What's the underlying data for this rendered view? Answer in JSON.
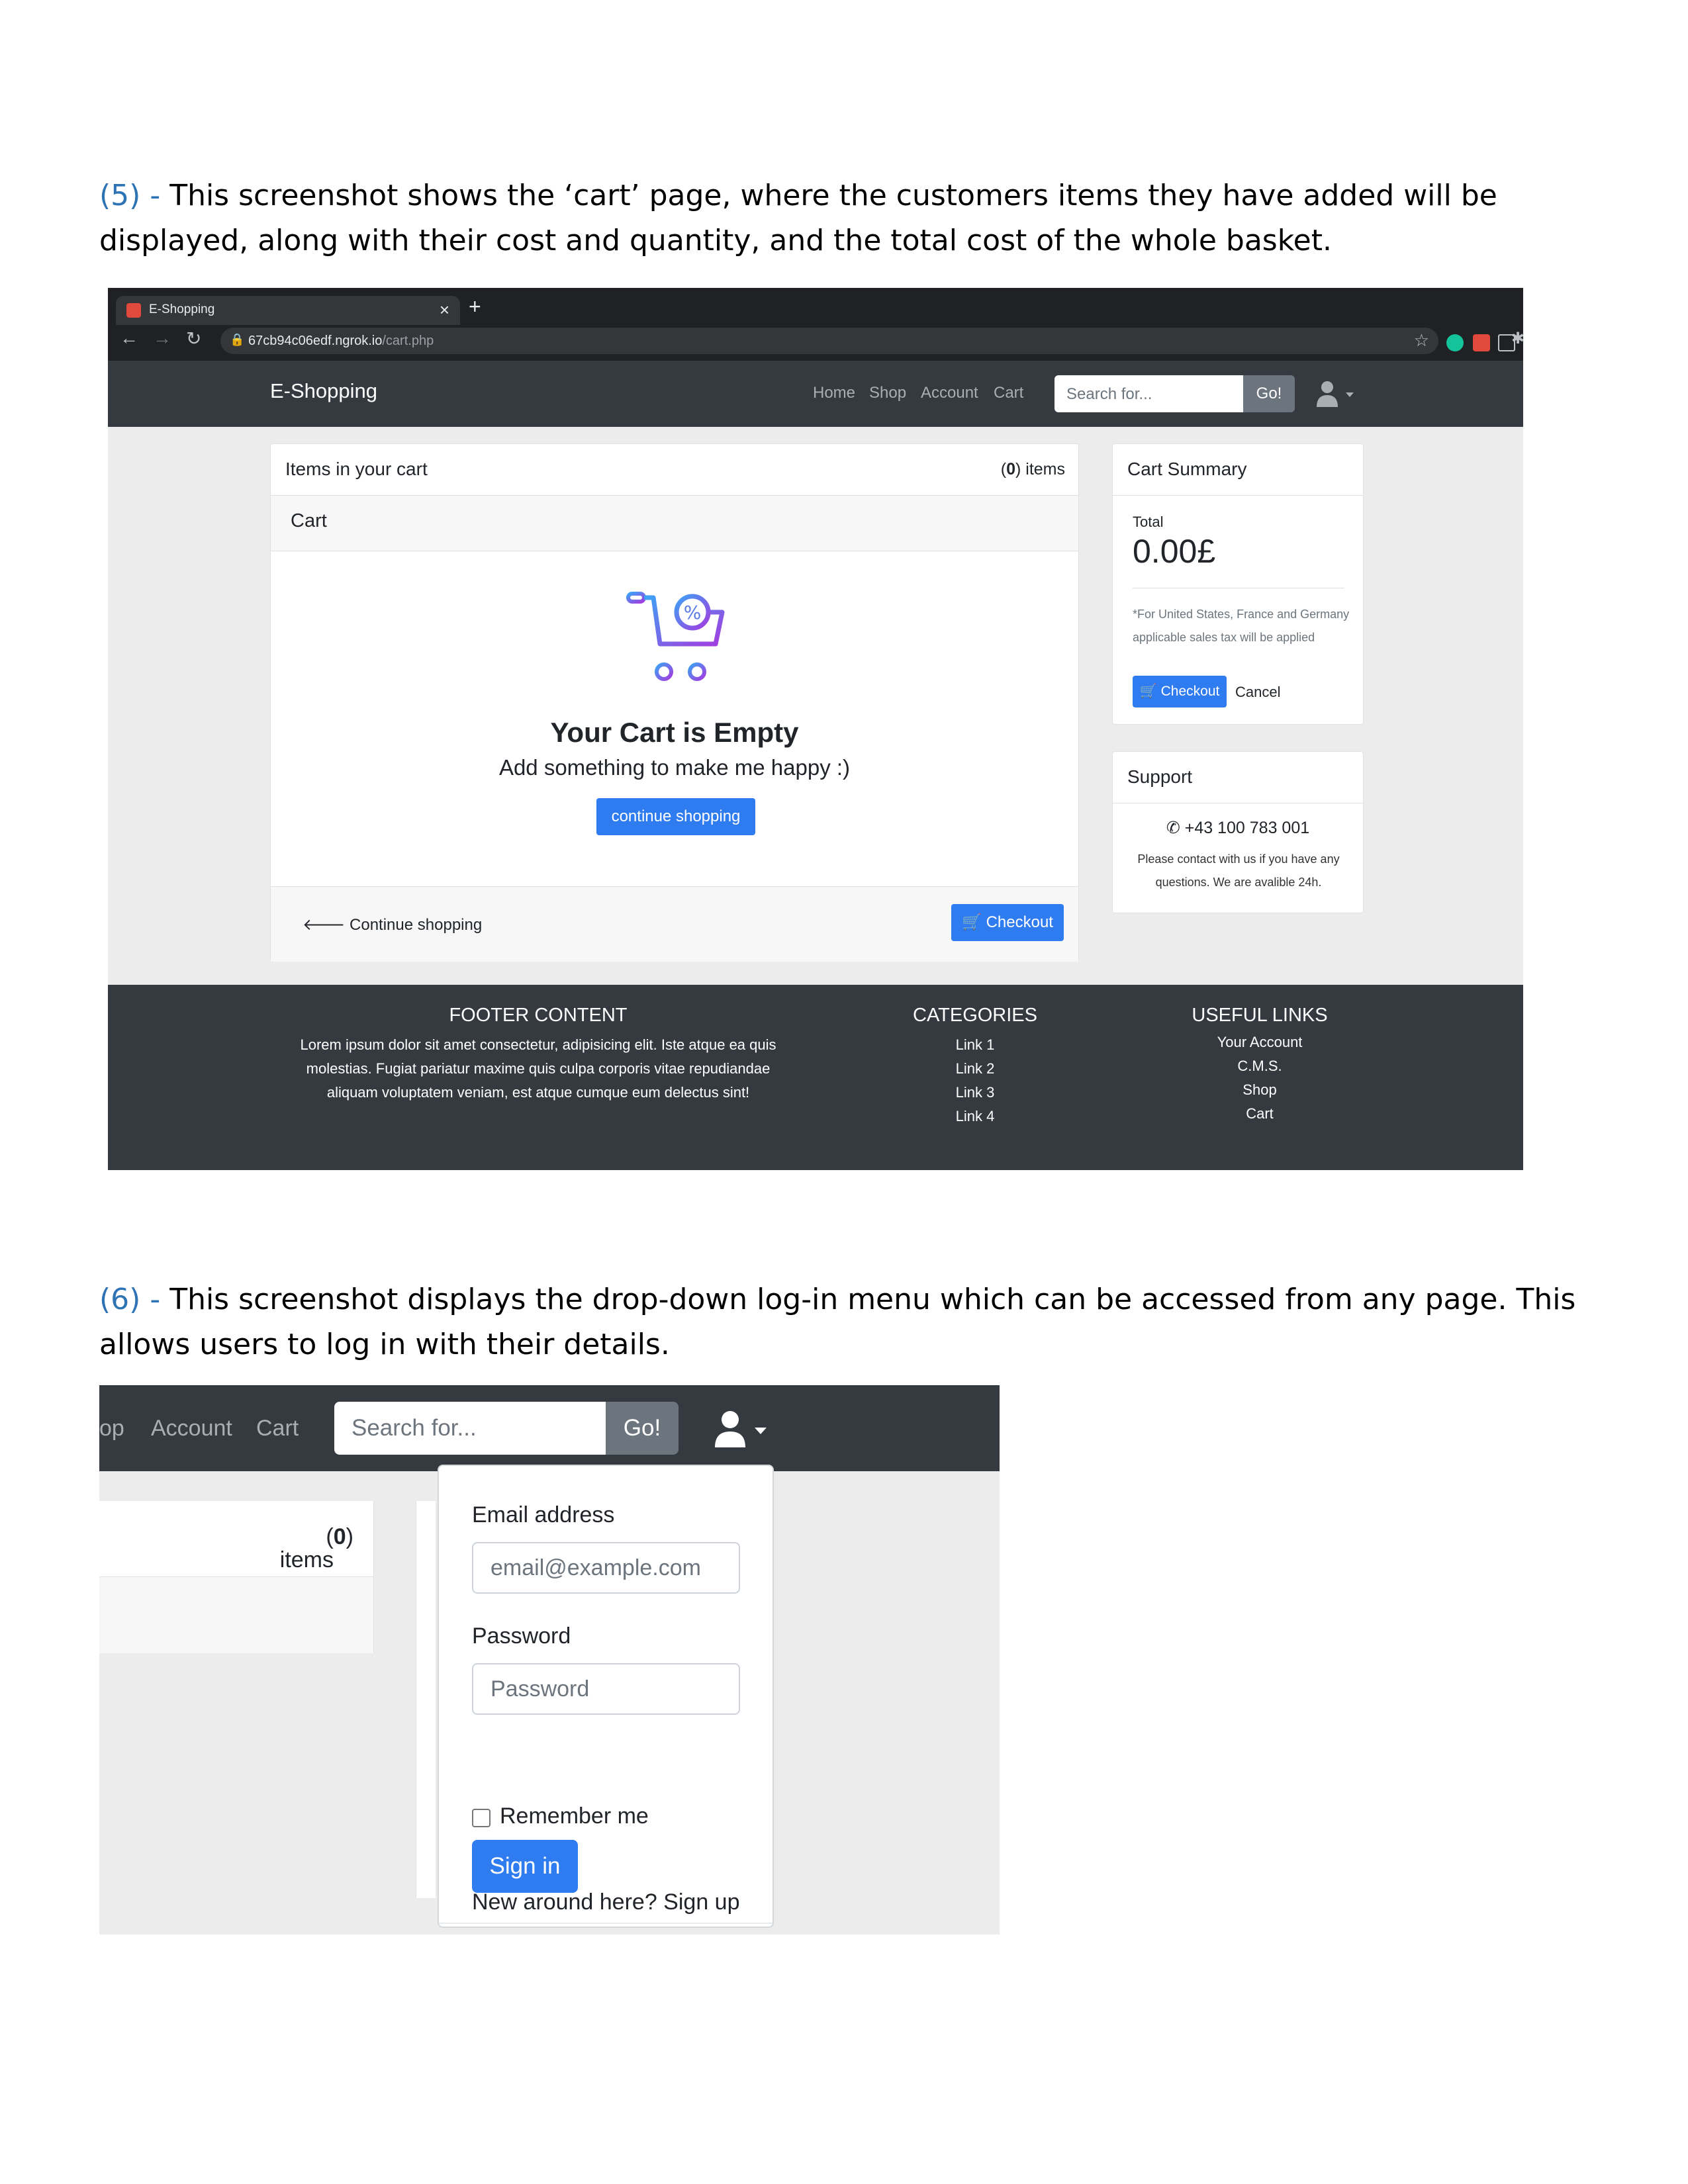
{
  "para5": {
    "num": "(5) -",
    "text": " This screenshot shows the ‘cart’ page, where the customers items they have added will be displayed, along with their cost and quantity, and the total cost of the whole basket."
  },
  "para6": {
    "num": "(6) -",
    "text": " This screenshot displays the drop-down log-in menu which can be accessed from any page. This allows users to log in with their details."
  },
  "browser": {
    "tab_title": "E-Shopping",
    "tab_close": "×",
    "new_tab": "+",
    "url_host": "67cb94c06edf.ngrok.io",
    "url_path": "/cart.php"
  },
  "site": {
    "brand": "E-Shopping",
    "nav": [
      "Home",
      "Shop",
      "Account",
      "Cart"
    ],
    "search_placeholder": "Search for...",
    "go": "Go!"
  },
  "cart": {
    "title": "Items in your cart",
    "count_num": "0",
    "count_suffix": " items",
    "sub": "Cart",
    "empty_title": "Your Cart is Empty",
    "empty_sub": "Add something to make me happy :)",
    "continue_btn": "continue shopping",
    "back_link": "Continue shopping",
    "checkout": "Checkout"
  },
  "summary": {
    "title": "Cart Summary",
    "total_label": "Total",
    "total_value": "0.00£",
    "tax_note": "*For United States, France and Germany applicable sales tax will be applied",
    "checkout": "Checkout",
    "cancel": "Cancel"
  },
  "support": {
    "title": "Support",
    "phone": "+43 100 783 001",
    "text": "Please contact with us if you have any questions. We are avalible 24h."
  },
  "footer": {
    "content_title": "FOOTER CONTENT",
    "content_text": "Lorem ipsum dolor sit amet consectetur, adipisicing elit. Iste atque ea quis molestias. Fugiat pariatur maxime quis culpa corporis vitae repudiandae aliquam voluptatem veniam, est atque cumque eum delectus sint!",
    "categories_title": "CATEGORIES",
    "categories": [
      "Link 1",
      "Link 2",
      "Link 3",
      "Link 4"
    ],
    "useful_title": "USEFUL LINKS",
    "useful": [
      "Your Account",
      "C.M.S.",
      "Shop",
      "Cart"
    ]
  },
  "login": {
    "nav": [
      "op",
      "Account",
      "Cart"
    ],
    "search_placeholder": "Search for...",
    "go": "Go!",
    "items_num": "0",
    "items_suffix": " items",
    "email_label": "Email address",
    "email_placeholder": "email@example.com",
    "password_label": "Password",
    "password_placeholder": "Password",
    "remember": "Remember me",
    "signin": "Sign in",
    "signup": "New around here? Sign up"
  },
  "colors": {
    "accent": "#2f7bf0",
    "navbar": "#343a40",
    "heading_blue": "#2e74b5"
  }
}
